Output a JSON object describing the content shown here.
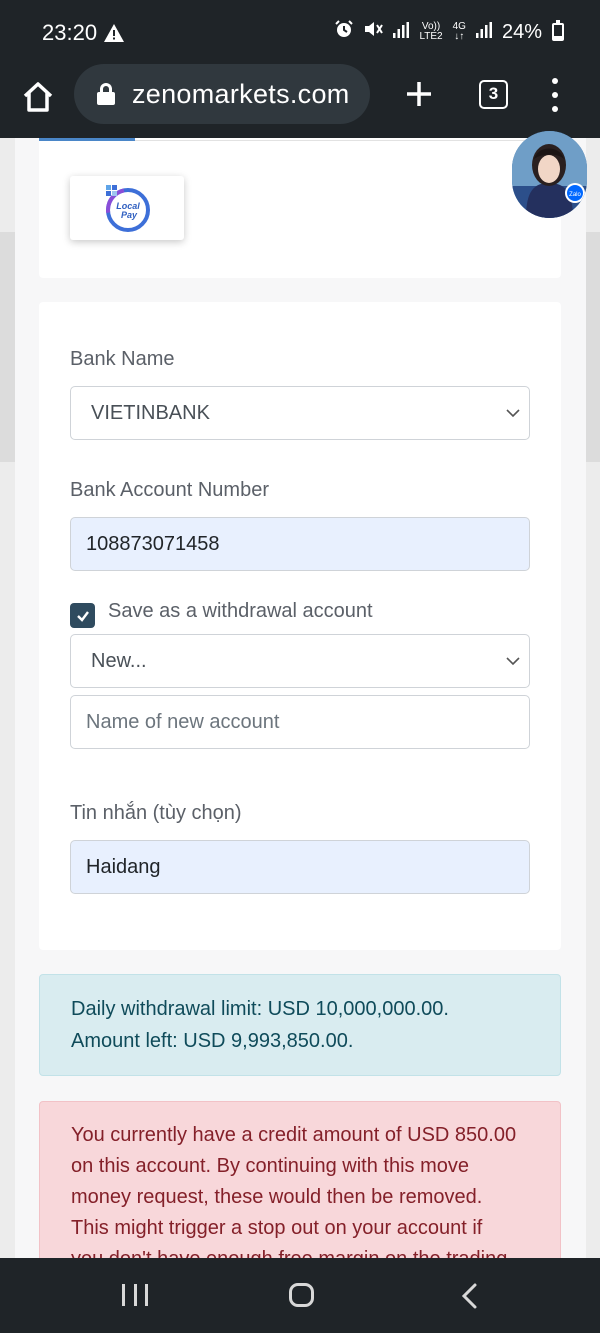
{
  "status_bar": {
    "time": "23:20",
    "network_label_top": "Vo))",
    "network_label_bottom": "LTE2",
    "network_type": "4G",
    "battery_percent": "24%",
    "battery_level": 0.24
  },
  "browser": {
    "url": "zenomarkets.com",
    "tab_count": "3"
  },
  "payment_methods": {
    "selected_method_logo_text_1": "Local",
    "selected_method_logo_text_2": "Pay",
    "accent_color": "#4a86c8"
  },
  "form": {
    "bank_name_label": "Bank Name",
    "bank_name_value": "VIETINBANK",
    "account_number_label": "Bank Account Number",
    "account_number_value": "108873071458",
    "save_account_label": "Save as a withdrawal account",
    "save_account_checked": true,
    "saved_account_select_value": "New...",
    "new_account_placeholder": "Name of new account",
    "message_label": "Tin nhắn (tùy chọn)",
    "message_value": "Haidang"
  },
  "info_alert": {
    "line1": "Daily withdrawal limit: USD 10,000,000.00.",
    "line2": "Amount left: USD 9,993,850.00."
  },
  "danger_alert": {
    "line1": "You currently have a credit amount of USD 850.00",
    "line2": "on this account. By continuing with this move",
    "line3": "money request, these would then be removed.",
    "line4": "This might trigger a stop out on your account if",
    "line5": "you don't have enough free margin on the trading"
  },
  "chat_widget": {
    "badge_text": "Zalo"
  }
}
